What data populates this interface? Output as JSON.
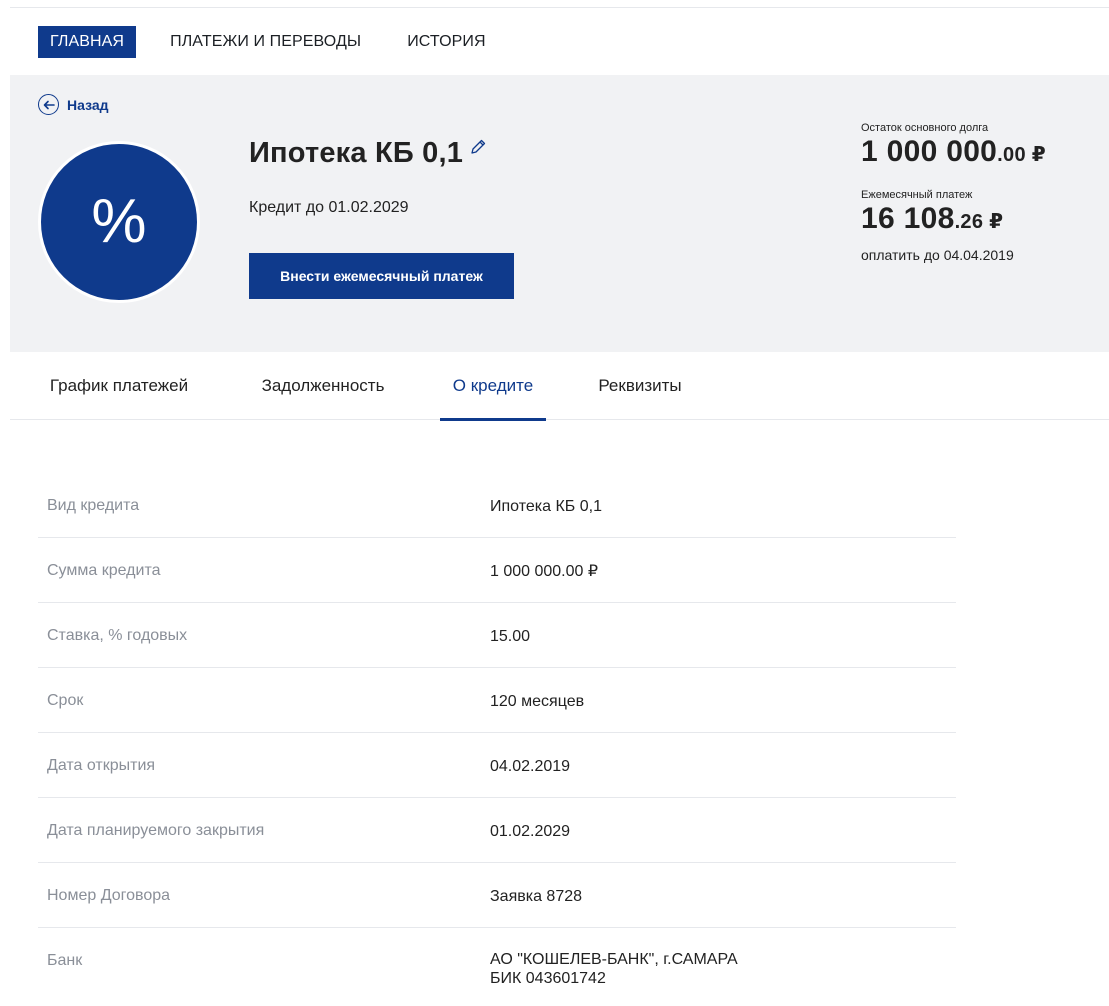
{
  "topnav": {
    "items": [
      {
        "label": "ГЛАВНАЯ",
        "active": true
      },
      {
        "label": "ПЛАТЕЖИ И ПЕРЕВОДЫ",
        "active": false
      },
      {
        "label": "ИСТОРИЯ",
        "active": false
      }
    ]
  },
  "hero": {
    "back_label": "Назад",
    "avatar_symbol": "%",
    "loan_name": "Ипотека КБ 0,1",
    "credit_until": "Кредит до 01.02.2029",
    "pay_button_label": "Внести ежемесячный платеж",
    "principal_caption": "Остаток основного долга",
    "principal_int": "1 000 000",
    "principal_frac": ".00 ₽",
    "monthly_caption": "Ежемесячный платеж",
    "monthly_int": "16 108",
    "monthly_frac": ".26 ₽",
    "due_text": "оплатить до 04.04.2019"
  },
  "tabs": [
    {
      "label": "График платежей",
      "active": false
    },
    {
      "label": "Задолженность",
      "active": false
    },
    {
      "label": "О кредите",
      "active": true
    },
    {
      "label": "Реквизиты",
      "active": false
    }
  ],
  "details": [
    {
      "label": "Вид кредита",
      "value": "Ипотека КБ 0,1"
    },
    {
      "label": "Сумма кредита",
      "value": "1 000 000.00 ₽"
    },
    {
      "label": "Ставка, % годовых",
      "value": "15.00"
    },
    {
      "label": "Срок",
      "value": "120 месяцев"
    },
    {
      "label": "Дата открытия",
      "value": "04.02.2019"
    },
    {
      "label": "Дата планируемого закрытия",
      "value": "01.02.2029"
    },
    {
      "label": "Номер Договора",
      "value": "Заявка 8728"
    },
    {
      "label": "Банк",
      "value": "АО \"КОШЕЛЕВ-БАНК\", г.САМАРА",
      "value2": "БИК 043601742"
    }
  ],
  "colors": {
    "brand": "#0f3a8c",
    "hero_bg": "#f1f2f4",
    "label_gray": "#8a8f98",
    "divider": "#e6e8ec"
  }
}
